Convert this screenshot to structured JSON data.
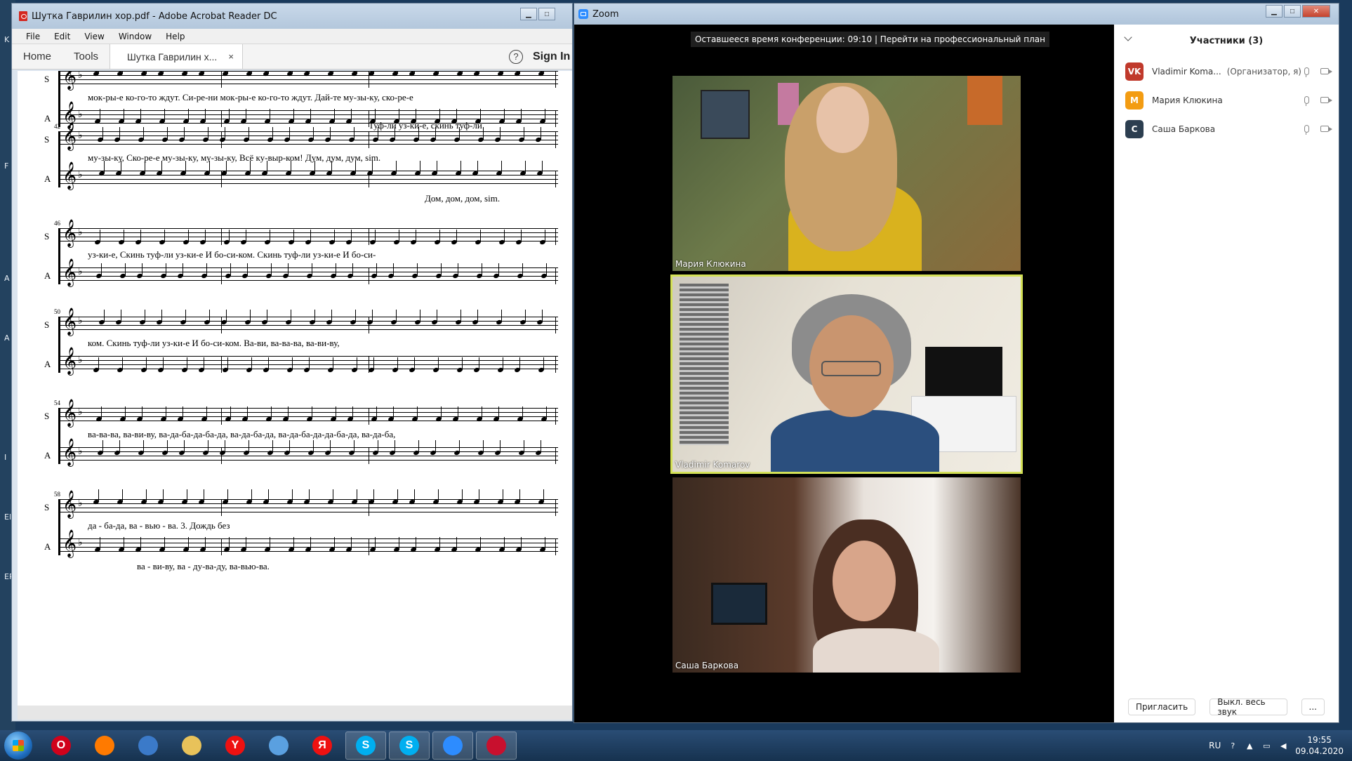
{
  "desktop": {
    "side_glyphs": [
      "K",
      "F",
      "A",
      "A",
      "I",
      "El",
      "EP"
    ]
  },
  "acrobat": {
    "title": "Шутка Гаврилин хор.pdf - Adobe Acrobat Reader DC",
    "menu": [
      "File",
      "Edit",
      "View",
      "Window",
      "Help"
    ],
    "tabs": {
      "home": "Home",
      "tools": "Tools",
      "doc": "Шутка Гаврилин х...",
      "close": "×"
    },
    "help": "?",
    "sign_in": "Sign In",
    "score": {
      "systems": [
        {
          "measure": "",
          "lyrics_top": "мок-ры-е  ко-го-то  ждут.    Си-ре-ни  мок-ры-е  ко-го-то  ждут.  Дай-те  му-зы-ку,  ско-ре-е",
          "lyrics_bottom": ""
        },
        {
          "measure": "42",
          "lyrics_top": "му-зы-ку,  Ско-ре-е   му-зы-ку, му-зы-ку, Всё ку-выр-ком!       Дум,  дум,  дум,    sim.",
          "lyrics_bottom": "Дом,  дом,  дом,    sim.",
          "lyrics_above": "Туф-ли  уз-ки-е,  скинь туф-ли"
        },
        {
          "measure": "46",
          "lyrics_top": "уз-ки-е, Скинь туф-ли  уз-ки-е    И бо-си-ком.       Скинь туф-ли  уз-ки-е    И бо-си-",
          "lyrics_bottom": ""
        },
        {
          "measure": "50",
          "lyrics_top": "ком.    Скинь  туф-ли   уз-ки-е    И бо-си-ком.        Ва-ви,      ва-ва-ва,  ва-ви-ву,",
          "lyrics_bottom": ""
        },
        {
          "measure": "54",
          "lyrics_top": "ва-ва-ва,   ва-ви-ву,     ва-да-ба-да-ба-да,  ва-да-ба-да,  ва-да-ба-да-да-ба-да,   ва-да-ба,",
          "lyrics_bottom": ""
        },
        {
          "measure": "58",
          "lyrics_top": "да - ба-да,                    ва   -   вью   -   ва.                           3. Дождь без",
          "lyrics_bottom": "ва - ви-ву,  ва - ду-ва-ду,  ва-вью-ва."
        }
      ],
      "voice_top": "S",
      "voice_bottom": "A"
    }
  },
  "zoom": {
    "title": "Zoom",
    "timer_banner": "Оставшееся время конференции: 09:10 | Перейти на профессиональный план",
    "tiles": [
      {
        "name": "Мария Клюкина",
        "active": false
      },
      {
        "name": "Vladimir Komarov",
        "active": true
      },
      {
        "name": "Саша Баркова",
        "active": false
      }
    ],
    "panel": {
      "title": "Участники (3)",
      "participants": [
        {
          "initials": "VK",
          "name": "Vladimir Koma...",
          "role": "(Организатор, я)",
          "color": "#c0392b"
        },
        {
          "initials": "M",
          "name": "Мария Клюкина",
          "role": "",
          "color": "#f39c12"
        },
        {
          "initials": "C",
          "name": "Саша Баркова",
          "role": "",
          "color": "#2c3e50"
        }
      ],
      "invite": "Пригласить",
      "mute_all": "Выкл. весь звук",
      "more": "..."
    }
  },
  "taskbar": {
    "lang": "RU",
    "time": "19:55",
    "date": "09.04.2020",
    "apps": [
      {
        "name": "opera",
        "glyph": "O",
        "color": "#d0021b"
      },
      {
        "name": "firefox",
        "glyph": "",
        "color": "#ff7a00"
      },
      {
        "name": "volume-app",
        "glyph": "",
        "color": "#3b7ac9"
      },
      {
        "name": "explorer",
        "glyph": "",
        "color": "#e8c25a"
      },
      {
        "name": "yandex-browser",
        "glyph": "Y",
        "color": "#e11"
      },
      {
        "name": "moon-app",
        "glyph": "",
        "color": "#5aa0e0"
      },
      {
        "name": "yandex",
        "glyph": "Я",
        "color": "#e11"
      },
      {
        "name": "skype-1",
        "glyph": "S",
        "color": "#00aff0"
      },
      {
        "name": "skype-2",
        "glyph": "S",
        "color": "#00aff0"
      },
      {
        "name": "zoom-app",
        "glyph": "",
        "color": "#2d8cff"
      },
      {
        "name": "acrobat-app",
        "glyph": "",
        "color": "#c8102e"
      }
    ]
  }
}
